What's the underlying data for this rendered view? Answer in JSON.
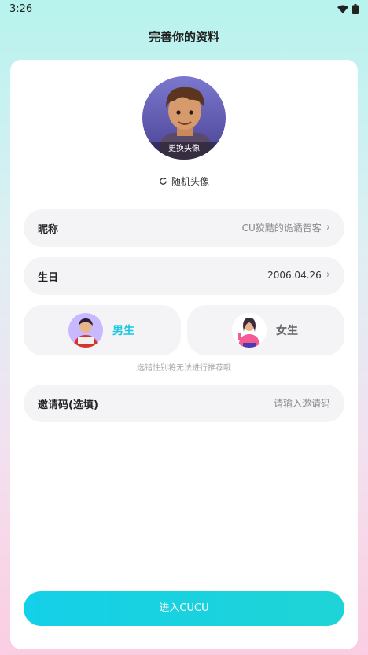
{
  "status_bar": {
    "time": "3:26"
  },
  "header": {
    "title": "完善你的资料"
  },
  "avatar": {
    "change_label": "更换头像"
  },
  "random_avatar": {
    "label": "随机头像"
  },
  "nickname": {
    "label": "昵称",
    "value": "CU狡黠的诡谲智客"
  },
  "birthday": {
    "label": "生日",
    "value": "2006.04.26"
  },
  "gender": {
    "male_label": "男生",
    "female_label": "女生",
    "selected": "male",
    "hint": "选错性别将无法进行推荐哦"
  },
  "invite_code": {
    "label": "邀请码(选填)",
    "placeholder": "请输入邀请码"
  },
  "enter_button": {
    "label": "进入CUCU"
  },
  "colors": {
    "accent": "#1fcfe0",
    "male_selected": "#17c7e0",
    "female_text": "#666666"
  }
}
